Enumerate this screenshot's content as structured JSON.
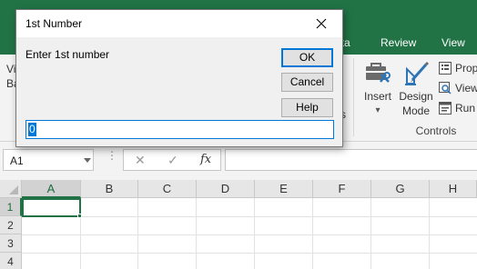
{
  "dialog": {
    "title": "1st Number",
    "prompt": "Enter 1st number",
    "ok_label": "OK",
    "cancel_label": "Cancel",
    "help_label": "Help",
    "input_value": "0"
  },
  "ribbon": {
    "tabs": [
      {
        "label": "ata",
        "partial": true
      },
      {
        "label": "Review"
      },
      {
        "label": "View"
      }
    ],
    "left_partial_lines": [
      "Vi",
      "Ba"
    ],
    "partial_s": "s",
    "insert_label": "Insert",
    "insert_dropdown": "▾",
    "design_mode_label_1": "Design",
    "design_mode_label_2": "Mode",
    "properties_label": "Prop",
    "view_code_label": "View",
    "run_dialog_label": "Run",
    "group_label": "Controls"
  },
  "formula_bar": {
    "name_box_value": "A1",
    "cancel_symbol": "✕",
    "enter_symbol": "✓",
    "fx_symbol": "fx",
    "formula_value": ""
  },
  "sheet": {
    "columns": [
      "A",
      "B",
      "C",
      "D",
      "E",
      "F",
      "G",
      "H"
    ],
    "rows": [
      "1",
      "2",
      "3",
      "4"
    ],
    "active_cell": "A1"
  },
  "colors": {
    "excel_green": "#217346",
    "focus_blue": "#0078d7",
    "dialog_bg": "#f0f0f0"
  },
  "icons": [
    "insert-controls-icon",
    "design-mode-icon",
    "properties-icon",
    "view-code-icon",
    "run-dialog-icon",
    "close-icon",
    "fx-icon"
  ]
}
